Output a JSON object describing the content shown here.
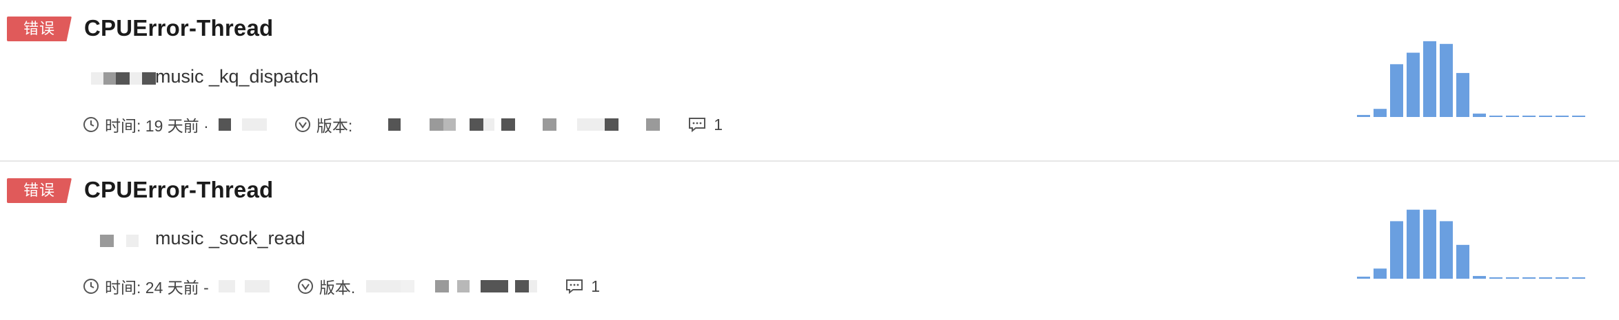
{
  "issues": [
    {
      "badge": "错误",
      "title": "CPUError-Thread",
      "function": "music _kq_dispatch",
      "time_label": "时间: 19 天前 ·",
      "version_label": "版本:",
      "comment_count": "1",
      "histogram": [
        3,
        12,
        78,
        95,
        112,
        108,
        65,
        5,
        2,
        2,
        2,
        2,
        2,
        2
      ],
      "bar_color": "#6a9fe0"
    },
    {
      "badge": "错误",
      "title": "CPUError-Thread",
      "function": "music _sock_read",
      "time_label": "时间: 24 天前 -",
      "version_label": "版本.",
      "comment_count": "1",
      "histogram": [
        3,
        15,
        85,
        102,
        102,
        85,
        50,
        4,
        2,
        2,
        2,
        2,
        2,
        2
      ],
      "bar_color": "#6a9fe0"
    }
  ],
  "colors": {
    "badge": "#e05a5a",
    "divider": "#e6e6e6",
    "bar": "#6a9fe0",
    "text": "#222222"
  },
  "icons": {
    "time": "clock-icon",
    "version": "version-icon",
    "comment": "comment-icon"
  }
}
